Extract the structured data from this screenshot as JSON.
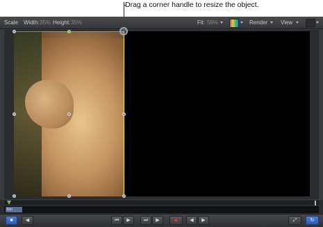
{
  "callout": {
    "text": "Drag a corner handle to resize the object."
  },
  "toolbar": {
    "scale_label": "Scale",
    "width_label": "Width:",
    "width_value": "35%",
    "height_label": "Height:",
    "height_value": "35%",
    "fit_label": "Fit:",
    "fit_value": "56%",
    "render_label": "Render",
    "view_label": "View"
  },
  "timeline": {
    "clip_label": "lion"
  },
  "transport": {
    "buttons": [
      "play-range-start",
      "back-frame",
      "go-to-start",
      "play",
      "go-to-end",
      "record",
      "prev-keyframe",
      "next-keyframe",
      "fullscreen",
      "loop"
    ]
  },
  "colors": {
    "selection": "#e6e63a",
    "playhead": "#73c140",
    "accent_blue": "#2f5ab3"
  }
}
